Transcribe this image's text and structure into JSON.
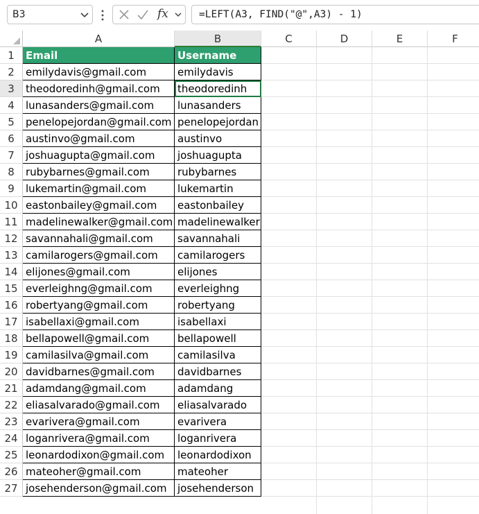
{
  "formula_bar": {
    "name_box": "B3",
    "formula": "=LEFT(A3, FIND(\"@\",A3) - 1)",
    "fx_label": "fx"
  },
  "columns": [
    "A",
    "B",
    "C",
    "D",
    "E",
    "F"
  ],
  "selected_column": "B",
  "selected_row": 3,
  "header_fill_color": "#2e9f6e",
  "table": {
    "headers": {
      "email": "Email",
      "username": "Username"
    },
    "rows": [
      {
        "num": "2",
        "email": "emilydavis@gmail.com",
        "username": "emilydavis"
      },
      {
        "num": "3",
        "email": "theodoredinh@gmail.com",
        "username": "theodoredinh"
      },
      {
        "num": "4",
        "email": "lunasanders@gmail.com",
        "username": "lunasanders"
      },
      {
        "num": "5",
        "email": "penelopejordan@gmail.com",
        "username": "penelopejordan"
      },
      {
        "num": "6",
        "email": "austinvo@gmail.com",
        "username": "austinvo"
      },
      {
        "num": "7",
        "email": "joshuagupta@gmail.com",
        "username": "joshuagupta"
      },
      {
        "num": "8",
        "email": "rubybarnes@gmail.com",
        "username": "rubybarnes"
      },
      {
        "num": "9",
        "email": "lukemartin@gmail.com",
        "username": "lukemartin"
      },
      {
        "num": "10",
        "email": "eastonbailey@gmail.com",
        "username": "eastonbailey"
      },
      {
        "num": "11",
        "email": "madelinewalker@gmail.com",
        "username": "madelinewalker"
      },
      {
        "num": "12",
        "email": "savannahali@gmail.com",
        "username": "savannahali"
      },
      {
        "num": "13",
        "email": "camilarogers@gmail.com",
        "username": "camilarogers"
      },
      {
        "num": "14",
        "email": "elijones@gmail.com",
        "username": "elijones"
      },
      {
        "num": "15",
        "email": "everleighng@gmail.com",
        "username": "everleighng"
      },
      {
        "num": "16",
        "email": "robertyang@gmail.com",
        "username": "robertyang"
      },
      {
        "num": "17",
        "email": "isabellaxi@gmail.com",
        "username": "isabellaxi"
      },
      {
        "num": "18",
        "email": "bellapowell@gmail.com",
        "username": "bellapowell"
      },
      {
        "num": "19",
        "email": "camilasilva@gmail.com",
        "username": "camilasilva"
      },
      {
        "num": "20",
        "email": "davidbarnes@gmail.com",
        "username": "davidbarnes"
      },
      {
        "num": "21",
        "email": "adamdang@gmail.com",
        "username": "adamdang"
      },
      {
        "num": "22",
        "email": "eliasalvarado@gmail.com",
        "username": "eliasalvarado"
      },
      {
        "num": "23",
        "email": "evarivera@gmail.com",
        "username": "evarivera"
      },
      {
        "num": "24",
        "email": "loganrivera@gmail.com",
        "username": "loganrivera"
      },
      {
        "num": "25",
        "email": "leonardodixon@gmail.com",
        "username": "leonardodixon"
      },
      {
        "num": "26",
        "email": "mateoher@gmail.com",
        "username": "mateoher"
      },
      {
        "num": "27",
        "email": "josehenderson@gmail.com",
        "username": "josehenderson"
      }
    ]
  }
}
